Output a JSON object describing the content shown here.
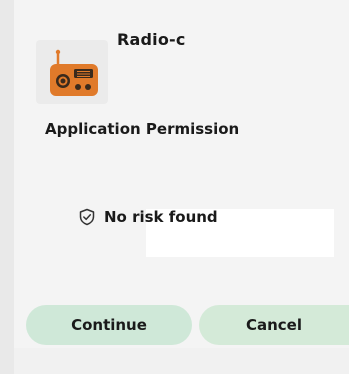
{
  "app": {
    "name": "Radio-c",
    "icon": "radio-icon"
  },
  "dialog": {
    "section_title": "Application Permission",
    "risk_status": "No risk found",
    "risk_icon": "shield-check-icon"
  },
  "buttons": {
    "continue_label": "Continue",
    "cancel_label": "Cancel"
  },
  "colors": {
    "icon_orange": "#e07a2a",
    "button_green": "#cfe8d8"
  }
}
